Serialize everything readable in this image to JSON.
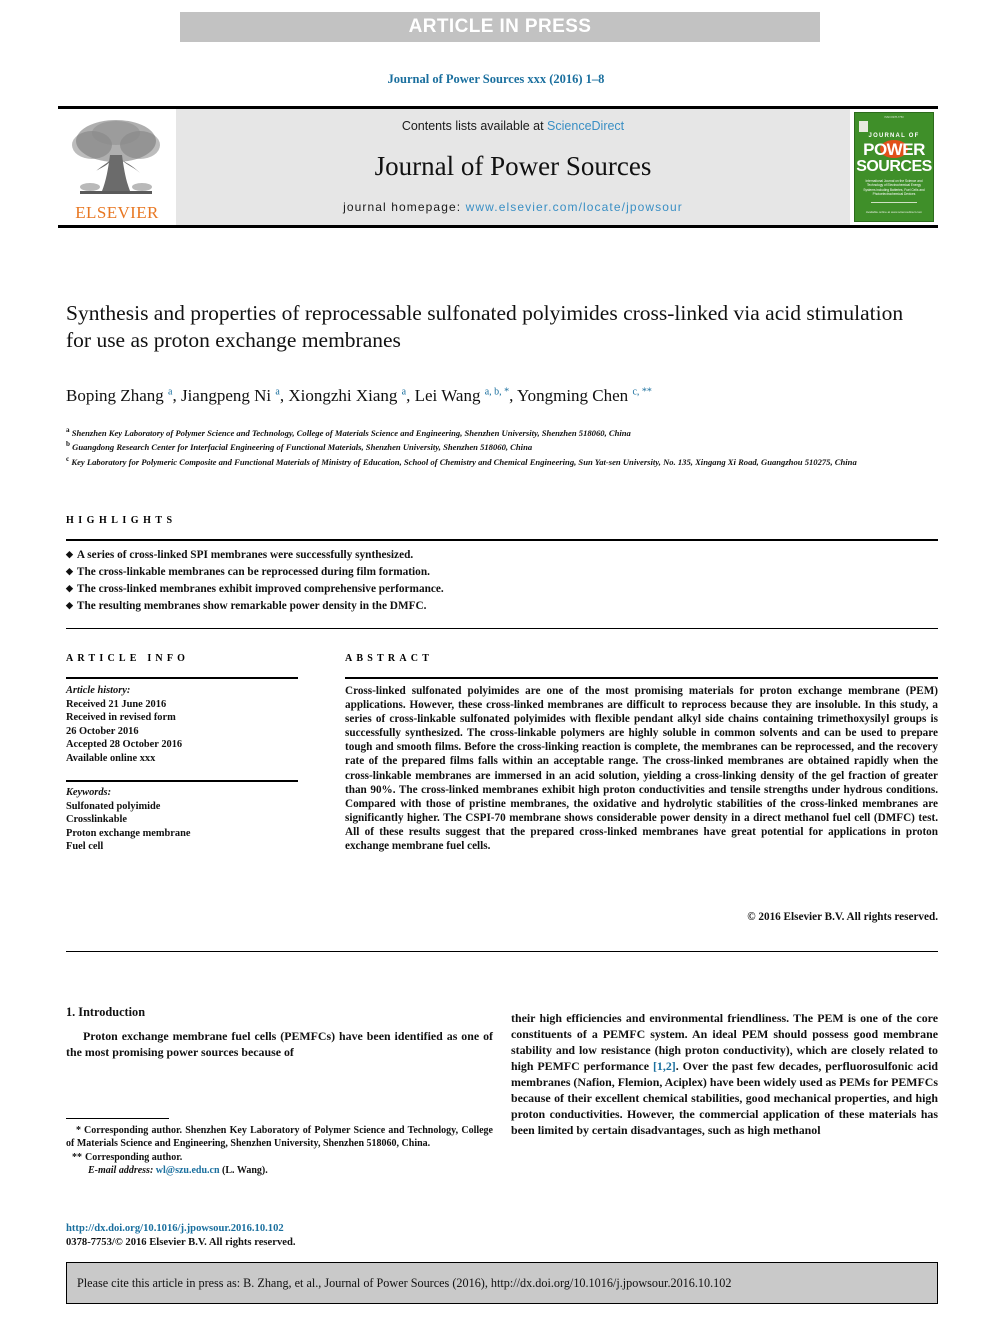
{
  "banner": {
    "text": "ARTICLE IN PRESS"
  },
  "journal_ref": "Journal of Power Sources xxx (2016) 1–8",
  "masthead": {
    "publisher_wordmark": "ELSEVIER",
    "contents_prefix": "Contents lists available at ",
    "contents_link": "ScienceDirect",
    "journal_title": "Journal of Power Sources",
    "homepage_label": "journal homepage: ",
    "homepage_url": "www.elsevier.com/locate/jpowsour",
    "cover": {
      "top_label": "ISSN 0378-7753",
      "line1": "JOURNAL OF",
      "line2": "POWER",
      "line3": "SOURCES",
      "subtitle": "International Journal on the Science and Technology of Electrochemical Energy Systems including Batteries, Fuel Cells and Photoelectrochemical Devices",
      "footer": "Available online at\nwww.sciencedirect.com"
    }
  },
  "article": {
    "title": "Synthesis and properties of reprocessable sulfonated polyimides cross-linked via acid stimulation for use as proton exchange membranes",
    "authors": [
      {
        "name": "Boping Zhang",
        "marks": "a"
      },
      {
        "name": "Jiangpeng Ni",
        "marks": "a"
      },
      {
        "name": "Xiongzhi Xiang",
        "marks": "a"
      },
      {
        "name": "Lei Wang",
        "marks": "a, b, *"
      },
      {
        "name": "Yongming Chen",
        "marks": "c, **"
      }
    ],
    "affiliations": [
      {
        "mark": "a",
        "text": "Shenzhen Key Laboratory of Polymer Science and Technology, College of Materials Science and Engineering, Shenzhen University, Shenzhen 518060, China"
      },
      {
        "mark": "b",
        "text": "Guangdong Research Center for Interfacial Engineering of Functional Materials, Shenzhen University, Shenzhen 518060, China"
      },
      {
        "mark": "c",
        "text": "Key Laboratory for Polymeric Composite and Functional Materials of Ministry of Education, School of Chemistry and Chemical Engineering, Sun Yat-sen University, No. 135, Xingang Xi Road, Guangzhou 510275, China"
      }
    ]
  },
  "highlights": {
    "heading": "HIGHLIGHTS",
    "items": [
      "A series of cross-linked SPI membranes were successfully synthesized.",
      "The cross-linkable membranes can be reprocessed during film formation.",
      "The cross-linked membranes exhibit improved comprehensive performance.",
      "The resulting membranes show remarkable power density in the DMFC."
    ]
  },
  "article_info": {
    "heading": "ARTICLE INFO",
    "history_label": "Article history:",
    "history": [
      "Received 21 June 2016",
      "Received in revised form",
      "26 October 2016",
      "Accepted 28 October 2016",
      "Available online xxx"
    ],
    "keywords_label": "Keywords:",
    "keywords": [
      "Sulfonated polyimide",
      "Crosslinkable",
      "Proton exchange membrane",
      "Fuel cell"
    ]
  },
  "abstract": {
    "heading": "ABSTRACT",
    "text": "Cross-linked sulfonated polyimides are one of the most promising materials for proton exchange membrane (PEM) applications. However, these cross-linked membranes are difficult to reprocess because they are insoluble. In this study, a series of cross-linkable sulfonated polyimides with flexible pendant alkyl side chains containing trimethoxysilyl groups is successfully synthesized. The cross-linkable polymers are highly soluble in common solvents and can be used to prepare tough and smooth films. Before the cross-linking reaction is complete, the membranes can be reprocessed, and the recovery rate of the prepared films falls within an acceptable range. The cross-linked membranes are obtained rapidly when the cross-linkable membranes are immersed in an acid solution, yielding a cross-linking density of the gel fraction of greater than 90%. The cross-linked membranes exhibit high proton conductivities and tensile strengths under hydrous conditions. Compared with those of pristine membranes, the oxidative and hydrolytic stabilities of the cross-linked membranes are significantly higher. The CSPI-70 membrane shows considerable power density in a direct methanol fuel cell (DMFC) test. All of these results suggest that the prepared cross-linked membranes have great potential for applications in proton exchange membrane fuel cells.",
    "copyright": "© 2016 Elsevier B.V. All rights reserved."
  },
  "body": {
    "section_heading": "1. Introduction",
    "left_paragraph": "Proton exchange membrane fuel cells (PEMFCs) have been identified as one of the most promising power sources because of",
    "right_before_ref": "their high efficiencies and environmental friendliness. The PEM is one of the core constituents of a PEMFC system. An ideal PEM should possess good membrane stability and low resistance (high proton conductivity), which are closely related to high PEMFC performance ",
    "right_ref": "[1,2]",
    "right_after_ref": ". Over the past few decades, perfluorosulfonic acid membranes (Nafion, Flemion, Aciplex) have been widely used as PEMs for PEMFCs because of their excellent chemical stabilities, good mechanical properties, and high proton conductivities. However, the commercial application of these materials has been limited by certain disadvantages, such as high methanol"
  },
  "footnotes": {
    "star1_mark": "*",
    "star1_text": "Corresponding author. Shenzhen Key Laboratory of Polymer Science and Technology, College of Materials Science and Engineering, Shenzhen University, Shenzhen 518060, China.",
    "star2_mark": "**",
    "star2_text": "Corresponding author.",
    "email_label": "E-mail address:",
    "email": "wl@szu.edu.cn",
    "email_owner": "(L. Wang).",
    "doi": "http://dx.doi.org/10.1016/j.jpowsour.2016.10.102",
    "issn_line": "0378-7753/© 2016 Elsevier B.V. All rights reserved."
  },
  "cite_box": {
    "text": "Please cite this article in press as: B. Zhang, et al., Journal of Power Sources (2016), http://dx.doi.org/10.1016/j.jpowsour.2016.10.102"
  },
  "colors": {
    "banner_bg": "#c2c2c2",
    "link_blue": "#1a6f9e",
    "elsevier_orange": "#e87722",
    "cover_green": "#3f8f29",
    "cover_orange": "#e2501a",
    "masthead_bg": "#e6e6e6",
    "cite_bg": "#c9c9c9"
  }
}
